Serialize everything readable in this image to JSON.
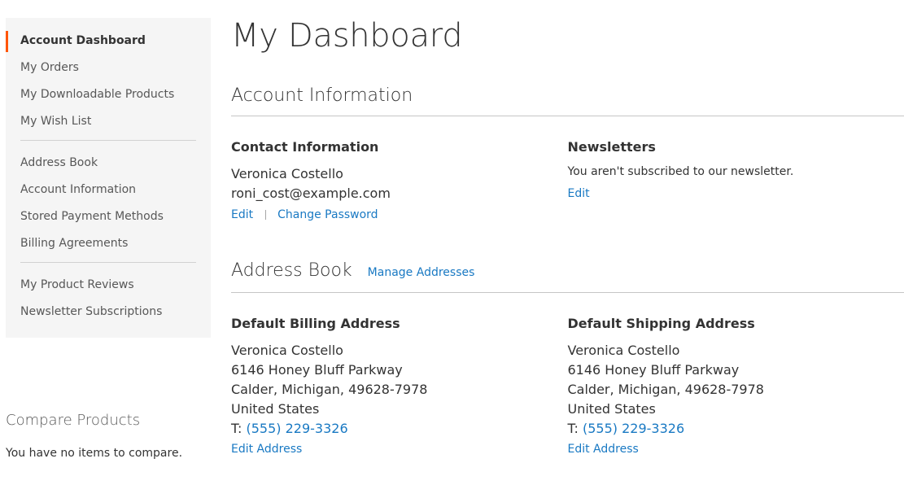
{
  "sidebar": {
    "items": [
      {
        "label": "Account Dashboard"
      },
      {
        "label": "My Orders"
      },
      {
        "label": "My Downloadable Products"
      },
      {
        "label": "My Wish List"
      },
      {
        "label": "Address Book"
      },
      {
        "label": "Account Information"
      },
      {
        "label": "Stored Payment Methods"
      },
      {
        "label": "Billing Agreements"
      },
      {
        "label": "My Product Reviews"
      },
      {
        "label": "Newsletter Subscriptions"
      }
    ],
    "accent_color": "#ff5501"
  },
  "compare": {
    "title": "Compare Products",
    "empty_text": "You have no items to compare."
  },
  "page": {
    "title": "My Dashboard"
  },
  "account_info": {
    "heading": "Account Information",
    "contact": {
      "title": "Contact Information",
      "name": "Veronica Costello",
      "email": "roni_cost@example.com",
      "edit_label": "Edit",
      "change_password_label": "Change Password"
    },
    "newsletters": {
      "title": "Newsletters",
      "status_text": "You aren't subscribed to our newsletter.",
      "edit_label": "Edit"
    }
  },
  "address_book": {
    "heading": "Address Book",
    "manage_label": "Manage Addresses",
    "billing": {
      "title": "Default Billing Address",
      "name": "Veronica Costello",
      "street": "6146 Honey Bluff Parkway",
      "city_line": "Calder, Michigan, 49628-7978",
      "country": "United States",
      "phone_prefix": "T: ",
      "phone": "(555) 229-3326",
      "edit_label": "Edit Address"
    },
    "shipping": {
      "title": "Default Shipping Address",
      "name": "Veronica Costello",
      "street": "6146 Honey Bluff Parkway",
      "city_line": "Calder, Michigan, 49628-7978",
      "country": "United States",
      "phone_prefix": "T: ",
      "phone": "(555) 229-3326",
      "edit_label": "Edit Address"
    }
  },
  "colors": {
    "link": "#1979c3",
    "sidebar_bg": "#f5f5f5"
  }
}
